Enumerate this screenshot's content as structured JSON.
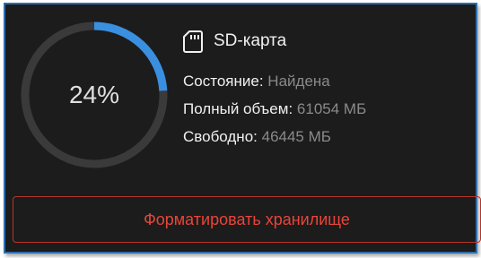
{
  "storage": {
    "title": "SD-карта",
    "icon": "sd-card-icon",
    "usage_percent": 24,
    "usage_label": "24%",
    "status_label": "Состояние:",
    "status_value": "Найдена",
    "total_label": "Полный объем:",
    "total_value": "61054 МБ",
    "free_label": "Свободно:",
    "free_value": "46445 МБ"
  },
  "actions": {
    "format_label": "Форматировать хранилище"
  },
  "colors": {
    "accent": "#3a8fe0",
    "track": "#3a3a3a",
    "danger": "#e8453a",
    "panel_bg": "#1c1c1c"
  }
}
